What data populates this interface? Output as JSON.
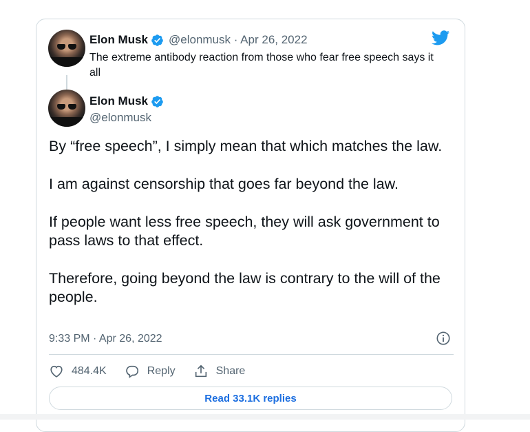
{
  "quoted_tweet": {
    "author_name": "Elon Musk",
    "handle_date": "@elonmusk · Apr 26, 2022",
    "text": "The extreme antibody reaction from those who fear free speech says it all"
  },
  "main_tweet": {
    "author_name": "Elon Musk",
    "handle": "@elonmusk",
    "paragraphs": [
      "By “free speech”, I simply mean that which matches the law.",
      "I am against censorship that goes far beyond the law.",
      "If people want less free speech, they will ask government to pass laws to that effect.",
      "Therefore, going beyond the law is contrary to the will of the people."
    ],
    "timestamp": "9:33 PM · Apr 26, 2022"
  },
  "actions": {
    "like_count": "484.4K",
    "reply_label": "Reply",
    "share_label": "Share"
  },
  "read_replies_label": "Read 33.1K replies",
  "icons": {
    "brand": "twitter-bird-icon",
    "verified": "verified-badge-icon",
    "info": "info-icon",
    "like": "heart-icon",
    "reply": "speech-bubble-icon",
    "share": "share-upload-icon"
  },
  "colors": {
    "twitter_blue": "#1d9bf0",
    "link_blue": "#1d6fe0",
    "secondary_text": "#536471",
    "border": "#cfd9de"
  }
}
